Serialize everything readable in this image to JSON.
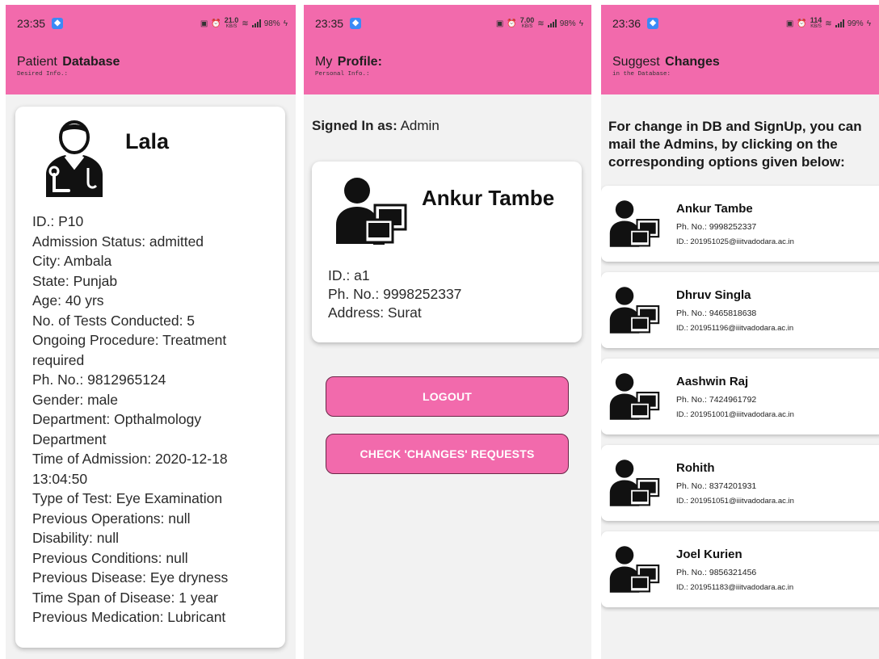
{
  "screens": [
    {
      "status": {
        "time": "23:35",
        "speed_value": "21.0",
        "speed_unit": "KB/S",
        "battery": "98%"
      },
      "title_prefix": "Patient",
      "title_bold": "Database",
      "subtitle": "Desired Info.:",
      "patient": {
        "avatar_icon": "doctor-avatar-icon",
        "name": "Lala",
        "fields": [
          "ID.: P10",
          "Admission Status: admitted",
          "City: Ambala",
          "State: Punjab",
          "Age: 40 yrs",
          "No. of Tests Conducted: 5",
          "Ongoing Procedure: Treatment required",
          "Ph. No.: 9812965124",
          "Gender: male",
          "Department: Opthalmology Department",
          "Time of Admission: 2020-12-18 13:04:50",
          "Type of Test: Eye Examination",
          "Previous Operations: null",
          "Disability: null",
          "Previous Conditions: null",
          "Previous Disease: Eye dryness",
          "Time Span of Disease: 1 year",
          "Previous Medication: Lubricant"
        ]
      }
    },
    {
      "status": {
        "time": "23:35",
        "speed_value": "7.00",
        "speed_unit": "KB/S",
        "battery": "98%"
      },
      "title_prefix": "My",
      "title_bold": "Profile:",
      "subtitle": "Personal Info.:",
      "signed_in_label": "Signed In as:",
      "signed_in_role": "Admin",
      "profile": {
        "avatar_icon": "admin-computer-icon",
        "name": "Ankur Tambe",
        "fields": [
          "ID.: a1",
          "Ph. No.: 9998252337",
          "Address: Surat"
        ]
      },
      "buttons": {
        "logout": "LOGOUT",
        "check_changes": "CHECK 'CHANGES' REQUESTS"
      }
    },
    {
      "status": {
        "time": "23:36",
        "speed_value": "114",
        "speed_unit": "KB/S",
        "battery": "99%"
      },
      "title_prefix": "Suggest",
      "title_bold": "Changes",
      "subtitle": "in the Database:",
      "note": "For change in DB and SignUp, you can mail the Admins, by clicking on the corresponding options given below:",
      "admins": [
        {
          "name": "Ankur Tambe",
          "phone": "Ph. No.: 9998252337",
          "email": "ID.: 201951025@iiitvadodara.ac.in"
        },
        {
          "name": "Dhruv Singla",
          "phone": "Ph. No.: 9465818638",
          "email": "ID.: 201951196@iiitvadodara.ac.in"
        },
        {
          "name": "Aashwin Raj",
          "phone": "Ph. No.: 7424961792",
          "email": "ID.: 201951001@iiitvadodara.ac.in"
        },
        {
          "name": "Rohith",
          "phone": "Ph. No.: 8374201931",
          "email": "ID.: 201951051@iiitvadodara.ac.in"
        },
        {
          "name": "Joel Kurien",
          "phone": "Ph. No.: 9856321456",
          "email": "ID.: 201951183@iiitvadodara.ac.in"
        }
      ]
    }
  ],
  "colors": {
    "appbar": "#f26aac",
    "background": "#f2f2f2",
    "card": "#ffffff",
    "button_border": "#6a2748"
  }
}
